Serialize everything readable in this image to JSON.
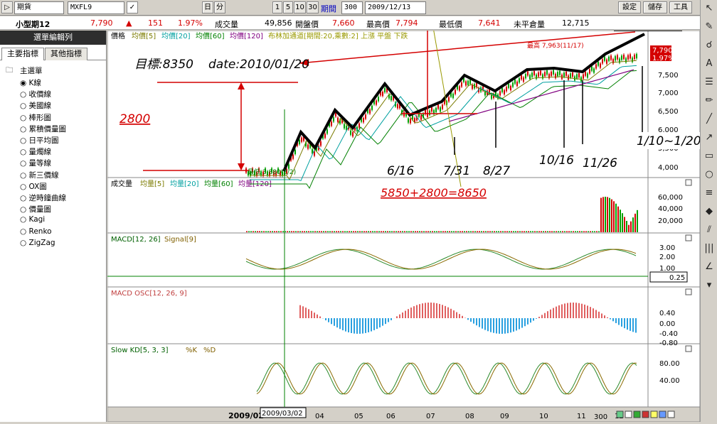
{
  "toolbar": {
    "play_glyph": "▷",
    "market": "期貨",
    "symbol": "MXFL9",
    "day_btn": "日",
    "min_btn": "分",
    "periods": [
      "1",
      "5",
      "10",
      "30"
    ],
    "period_label": "期間",
    "period_value": "300",
    "date_value": "2009/12/13",
    "settings": "設定",
    "save": "儲存",
    "tools": "工具"
  },
  "quote": {
    "name": "小型期12",
    "price": "7,790",
    "change_arrow": "▲",
    "change": "151",
    "pct": "1.97%",
    "vol_label": "成交量",
    "vol": "49,856",
    "open_label": "開盤價",
    "open": "7,660",
    "high_label": "最高價",
    "high": "7,794",
    "low_label": "最低價",
    "low": "7,641",
    "oi_label": "未平倉量",
    "oi": "12,715"
  },
  "sidebar": {
    "title": "選單編輯列",
    "tab_main": "主要指標",
    "tab_other": "其他指標",
    "root": "主選單",
    "items": [
      "K線",
      "收價線",
      "美國線",
      "棒形圖",
      "累積價量圖",
      "日平均圖",
      "量燭線",
      "量等線",
      "新三價線",
      "OX圖",
      "逆時鐘曲線",
      "價量圖",
      "Kagi",
      "Renko",
      "ZigZag"
    ]
  },
  "panels": {
    "price": {
      "title": "價格",
      "legend": [
        "均價[5]",
        "均價[20]",
        "均價[60]",
        "均價[120]"
      ],
      "bb": "布林加通道[期間:20,乘數:2] 上漲 平盤 下跌",
      "ticks": [
        "7,500",
        "7,000",
        "6,500",
        "6,000",
        "5,500",
        "4,000"
      ],
      "last": "7,790",
      "last_pct": "1.97%",
      "high_note": "最高 7,963(11/17)",
      "low_note": "最低 3,880(2/2)"
    },
    "volume": {
      "title": "成交量",
      "legend": [
        "均量[5]",
        "均量[20]",
        "均量[60]",
        "均量[120]"
      ],
      "ticks": [
        "60,000",
        "40,000",
        "20,000"
      ]
    },
    "macd": {
      "title": "MACD[12, 26]",
      "signal": "Signal[9]",
      "ticks": [
        "3.00",
        "2.00",
        "1.00"
      ],
      "box": "0.25"
    },
    "osc": {
      "title": "MACD OSC[12, 26, 9]",
      "ticks": [
        "0.40",
        "0.00",
        "-0.40",
        "-0.80"
      ]
    },
    "kd": {
      "title": "Slow KD[5, 3, 3]",
      "k": "%K",
      "d": "%D",
      "ticks": [
        "80.00",
        "40.00"
      ]
    }
  },
  "xaxis": {
    "labels": [
      "2009/02",
      "04",
      "05",
      "06",
      "07",
      "08",
      "09",
      "10",
      "11",
      "12"
    ],
    "cursor_date": "2009/03/02",
    "zoom": "300"
  },
  "annotations": {
    "target": "目標:8350",
    "target_date": "date:2010/01/20",
    "range": "2800",
    "calc": "5850+2800=8650",
    "dates": [
      "6/16",
      "7/31",
      "8/27",
      "10/16",
      "11/26",
      "1/10~1/20"
    ]
  },
  "colors": {
    "up": "#d40000",
    "down": "#00a000",
    "ma5": "#7b7b00",
    "ma20": "#00a0a0",
    "ma60": "#008000",
    "ma120": "#800080"
  }
}
